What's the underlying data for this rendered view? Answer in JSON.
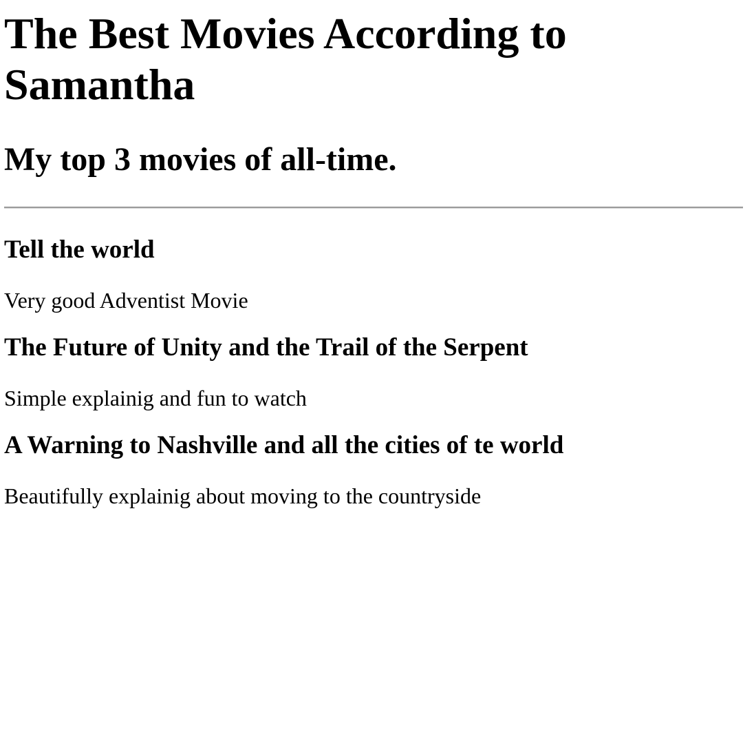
{
  "page": {
    "title": "The Best Movies According to Samantha",
    "subtitle": "My top 3 movies of all-time."
  },
  "movies": [
    {
      "title": "Tell the world",
      "description": "Very good Adventist Movie"
    },
    {
      "title": "The Future of Unity and the Trail of the Serpent",
      "description": "Simple explainig and fun to watch"
    },
    {
      "title": "A Warning to Nashville and all the cities of te world",
      "description": "Beautifully explainig about moving to the countryside"
    }
  ]
}
